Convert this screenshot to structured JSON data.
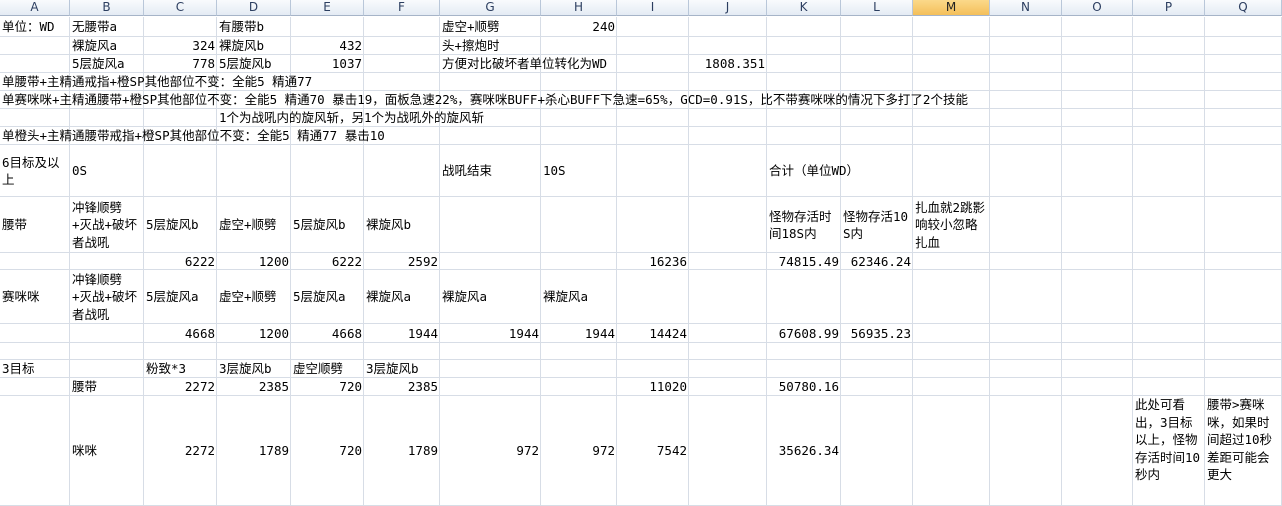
{
  "columns": [
    "A",
    "B",
    "C",
    "D",
    "E",
    "F",
    "G",
    "H",
    "I",
    "J",
    "K",
    "L",
    "M",
    "N",
    "O",
    "P",
    "Q"
  ],
  "selected_column": "M",
  "cells": {
    "A1": "单位：WD",
    "B1": "无腰带a",
    "D1": "有腰带b",
    "G1": "虚空+顺劈",
    "H1": "240",
    "B2": "裸旋风a",
    "C2": "324",
    "D2": "裸旋风b",
    "E2": "432",
    "G2": "头+擦炮时",
    "B3": "5层旋风a",
    "C3": "778",
    "D3": "5层旋风b",
    "E3": "1037",
    "G3": "方便对比破坏者单位转化为WD",
    "J3": "1808.351",
    "A4": "单腰带+主精通戒指+橙SP其他部位不变：全能5 精通77",
    "A5": "单赛咪咪+主精通腰带+橙SP其他部位不变：全能5 精通70 暴击19，面板急速22%，赛咪咪BUFF+杀心BUFF下急速=65%，GCD=0.91S，比不带赛咪咪的情况下多打了2个技能",
    "D6": "1个为战吼内的旋风斩，另1个为战吼外的旋风斩",
    "A7": "单橙头+主精通腰带戒指+橙SP其他部位不变：全能5 精通77 暴击10",
    "A8": "6目标及以上",
    "B8": "0S",
    "G8": "战吼结束",
    "H8": "10S",
    "K8": "合计（单位WD）",
    "A9": "腰带",
    "B9": "冲锋顺劈+灭战+破坏者战吼",
    "C9": "5层旋风b",
    "D9": "虚空+顺劈",
    "E9": "5层旋风b",
    "F9": "裸旋风b",
    "K9": "怪物存活时间18S内",
    "L9": "怪物存活10S内",
    "M9": "扎血就2跳影响较小忽略扎血",
    "C10": "6222",
    "D10": "1200",
    "E10": "6222",
    "F10": "2592",
    "I10": "16236",
    "K10": "74815.49",
    "L10": "62346.24",
    "A11": "赛咪咪",
    "B11": "冲锋顺劈+灭战+破坏者战吼",
    "C11": "5层旋风a",
    "D11": "虚空+顺劈",
    "E11": "5层旋风a",
    "F11": "裸旋风a",
    "G11": "裸旋风a",
    "H11": "裸旋风a",
    "C12": "4668",
    "D12": "1200",
    "E12": "4668",
    "F12": "1944",
    "G12": "1944",
    "H12": "1944",
    "I12": "14424",
    "K12": "67608.99",
    "L12": "56935.23",
    "A14": "3目标",
    "C14": "粉致*3",
    "D14": "3层旋风b",
    "E14": "虚空顺劈",
    "F14": "3层旋风b",
    "B15": "腰带",
    "C15": "2272",
    "D15": "2385",
    "E15": "720",
    "F15": "2385",
    "I15": "11020",
    "K15": "50780.16",
    "B16": "咪咪",
    "C16": "2272",
    "D16": "1789",
    "E16": "720",
    "F16": "1789",
    "G16": "972",
    "H16": "972",
    "I16": "7542",
    "K16": "35626.34",
    "P16": "此处可看出，3目标以上，怪物存活时间10秒内",
    "Q16": "腰带>赛咪咪，如果时间超过10秒差距可能会更大"
  }
}
